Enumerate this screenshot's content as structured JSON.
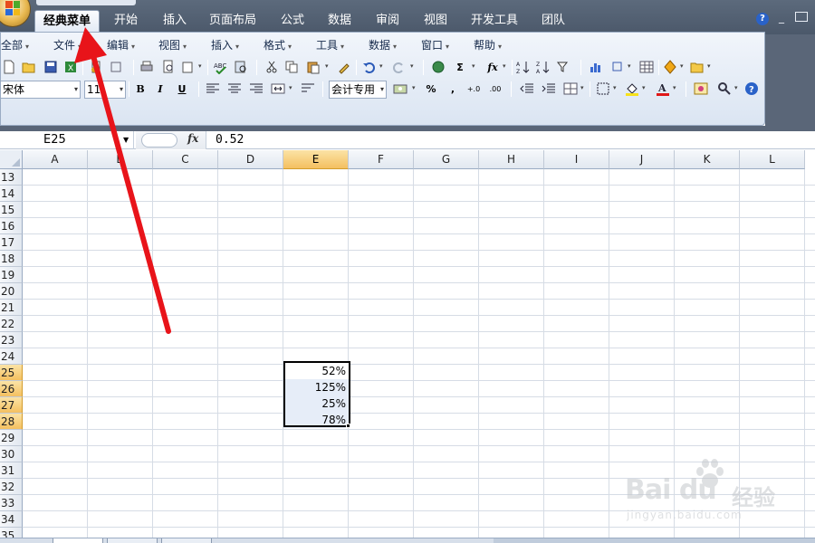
{
  "tabs": [
    {
      "label": "经典菜单",
      "active": true
    },
    {
      "label": "开始"
    },
    {
      "label": "插入"
    },
    {
      "label": "页面布局"
    },
    {
      "label": "公式"
    },
    {
      "label": "数据"
    },
    {
      "label": "审阅"
    },
    {
      "label": "视图"
    },
    {
      "label": "开发工具"
    },
    {
      "label": "团队"
    }
  ],
  "window_controls": {
    "help": "?",
    "minimize": "_"
  },
  "classic_menu": [
    {
      "label": "全部"
    },
    {
      "label": "文件"
    },
    {
      "label": "编辑"
    },
    {
      "label": "视图"
    },
    {
      "label": "插入"
    },
    {
      "label": "格式"
    },
    {
      "label": "工具"
    },
    {
      "label": "数据"
    },
    {
      "label": "窗口"
    },
    {
      "label": "帮助"
    }
  ],
  "toolbar": {
    "font_name": "宋体",
    "font_size": "11",
    "number_format": "会计专用",
    "bold": "B",
    "italic": "I",
    "underline": "U",
    "percent": "%",
    "comma": ","
  },
  "formula_bar": {
    "name_box": "E25",
    "fx_label": "fx",
    "formula": "0.52"
  },
  "columns": [
    "A",
    "B",
    "C",
    "D",
    "E",
    "F",
    "G",
    "H",
    "I",
    "J",
    "K",
    "L"
  ],
  "selected_column": "E",
  "rows": [
    "13",
    "14",
    "15",
    "16",
    "17",
    "18",
    "19",
    "20",
    "21",
    "22",
    "23",
    "24",
    "25",
    "26",
    "27",
    "28",
    "29",
    "30",
    "31",
    "32",
    "33",
    "34",
    "35"
  ],
  "selected_rows": [
    "25",
    "26",
    "27",
    "28"
  ],
  "cells": [
    {
      "ref": "E25",
      "value": "52%"
    },
    {
      "ref": "E26",
      "value": "125%"
    },
    {
      "ref": "E27",
      "value": "25%"
    },
    {
      "ref": "E28",
      "value": "78%"
    }
  ],
  "colors": {
    "arrow": "#e8141a",
    "selection_header": "#f4c060",
    "selected_cells": "#e6edf8"
  },
  "watermark": {
    "logo": "Bai du",
    "cn": "经验",
    "url": "jingyan.baidu.com"
  }
}
